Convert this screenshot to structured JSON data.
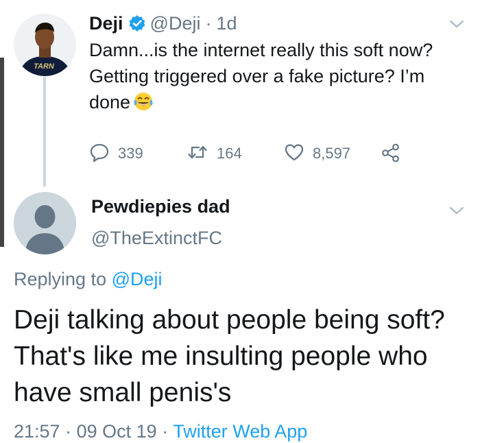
{
  "parent_tweet": {
    "display_name": "Deji",
    "handle": "@Deji",
    "separator": "·",
    "time_ago": "1d",
    "text": "Damn...is the internet really this soft now? Getting triggered over a fake picture? I’m done",
    "emoji": "face-with-tears-of-joy",
    "avatar_shirt_text": "TARN",
    "reply_count": "339",
    "retweet_count": "164",
    "like_count": "8,597"
  },
  "reply_tweet": {
    "display_name": "Pewdiepies dad",
    "handle": "@TheExtinctFC",
    "replying_to_label": "Replying to",
    "replying_to_handle": "@Deji",
    "text": "Deji talking about people being soft? That's like me insulting people who have small penis's",
    "time": "21:57",
    "separator_1": "·",
    "date": "09 Oct 19",
    "separator_2": "·",
    "source": "Twitter Web App"
  },
  "colors": {
    "text_primary": "#14171a",
    "text_secondary": "#657786",
    "accent_blue": "#1da1f2",
    "thread_line": "#ccd6dd",
    "default_avatar": "#ccd6dd"
  }
}
